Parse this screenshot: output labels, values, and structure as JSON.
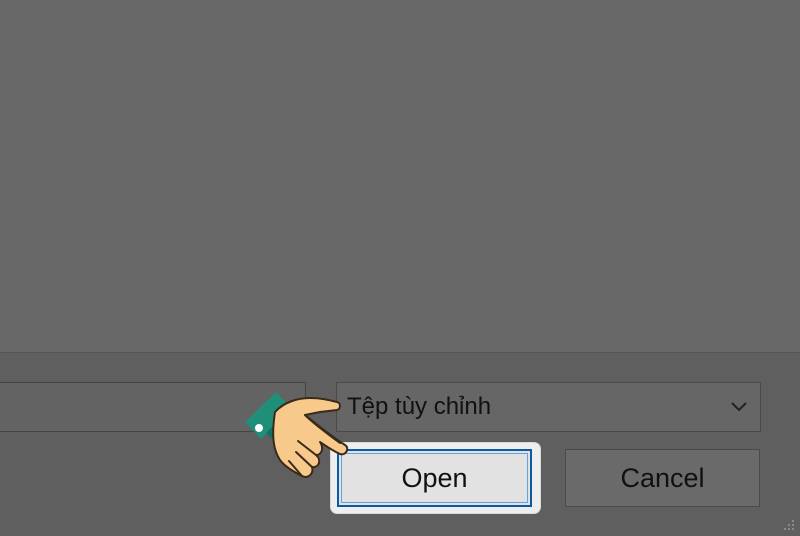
{
  "file_dialog": {
    "filename_field": {
      "value": "",
      "placeholder": ""
    },
    "file_type_select": {
      "selected": "Tệp tùy chỉnh"
    },
    "buttons": {
      "open_label": "Open",
      "cancel_label": "Cancel"
    }
  },
  "icons": {
    "dropdown": "chevron-down-icon",
    "pointer": "pointing-hand-icon",
    "grip": "resize-grip-icon"
  },
  "colors": {
    "overlay": "#666666",
    "focus_border": "#0b5aa6",
    "highlight": "#eeeeee",
    "hand_skin": "#f7c98a",
    "hand_cuff": "#1f8f7a"
  }
}
